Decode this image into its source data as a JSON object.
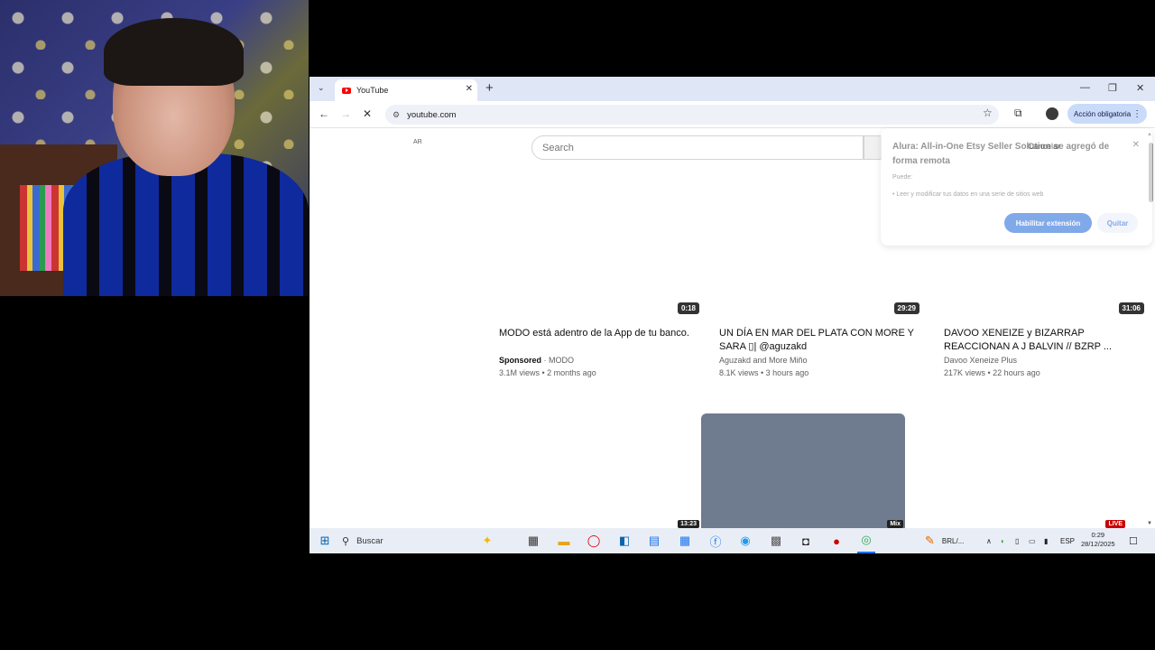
{
  "browser": {
    "tab_title": "YouTube",
    "url": "youtube.com",
    "action_button": "Acción obligatoria"
  },
  "youtube": {
    "region": "AR",
    "search_placeholder": "Search",
    "videos": [
      {
        "duration": "0:18",
        "title": "MODO está adentro de la App de tu banco.",
        "sponsored": "Sponsored",
        "channel": "MODO",
        "meta": "3.1M views • 2 months ago"
      },
      {
        "duration": "29:29",
        "title": "UN DÍA EN MAR DEL PLATA CON MORE Y SARA ▯| @aguzakd",
        "channel": "Aguzakd and More Miño",
        "meta": "8.1K views • 3 hours ago"
      },
      {
        "duration": "31:06",
        "title": "DAVOO XENEIZE y BIZARRAP REACCIONAN A J BALVIN // BZRP ...",
        "channel": "Davoo Xeneize Plus",
        "meta": "217K views • 22 hours ago"
      }
    ],
    "row2_badges": [
      "13:23",
      "Mix",
      "LIVE"
    ]
  },
  "extension_popup": {
    "title": "Alura: All-in-One Etsy Seller Solution se agregó de forma remota",
    "cancel_label": "Cancelar",
    "subtitle": "Puede:",
    "permission": "• Leer y modificar tus datos en una serie de sitios web",
    "enable_label": "Habilitar extensión",
    "remove_label": "Quitar"
  },
  "taskbar": {
    "search_label": "Buscar",
    "app_label": "BRL/...",
    "language": "ESP",
    "time": "0:29",
    "date": "28/12/2025"
  },
  "colors": {
    "accent": "#1a63d8",
    "youtube_red": "#ff0000",
    "tabbar": "#dfe6f5",
    "taskbar": "#e9eef6"
  }
}
